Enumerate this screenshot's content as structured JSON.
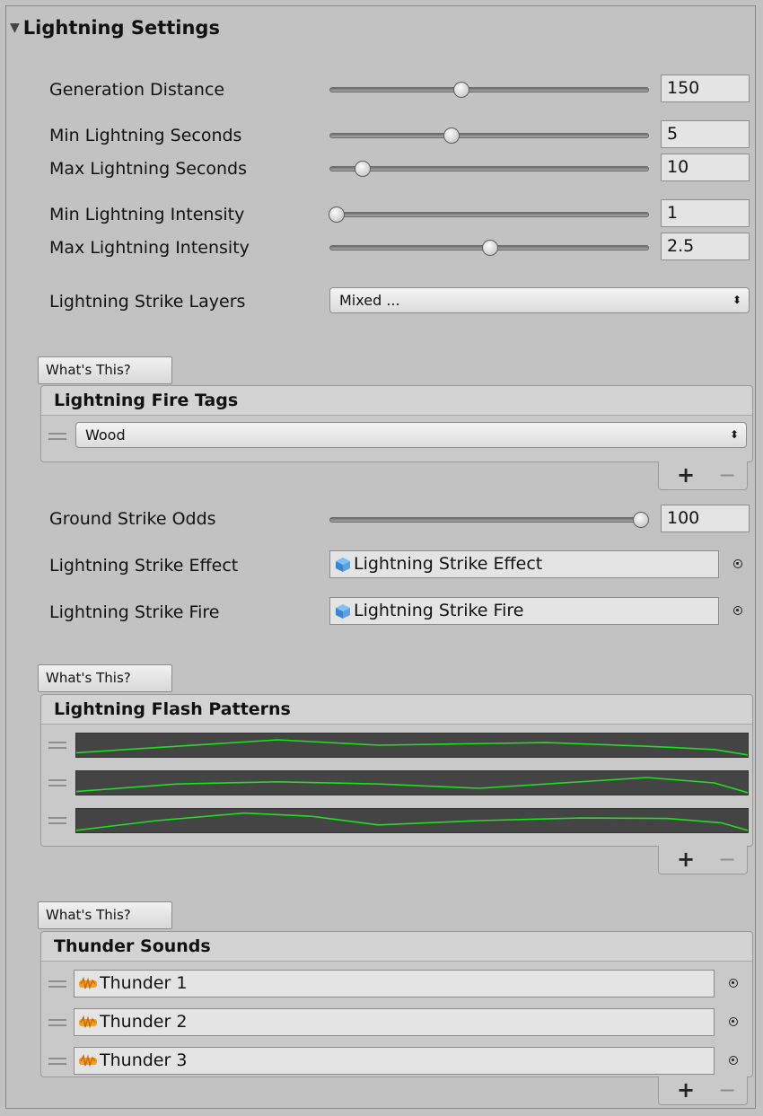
{
  "title": "Lightning Settings",
  "sliders": [
    {
      "label": "Generation Distance",
      "value": "150",
      "fraction": 0.41
    },
    {
      "label": "Min Lightning Seconds",
      "value": "5",
      "fraction": 0.38
    },
    {
      "label": "Max Lightning Seconds",
      "value": "10",
      "fraction": 0.1
    },
    {
      "label": "Min Lightning Intensity",
      "value": "1",
      "fraction": 0.02
    },
    {
      "label": "Max Lightning Intensity",
      "value": "2.5",
      "fraction": 0.5
    }
  ],
  "strike_layers": {
    "label": "Lightning Strike Layers",
    "value": "Mixed ..."
  },
  "whats_this": "What's This?",
  "fire_tags": {
    "header": "Lightning Fire Tags",
    "items": [
      "Wood"
    ]
  },
  "ground_strike": {
    "label": "Ground Strike Odds",
    "value": "100",
    "fraction": 1.0
  },
  "strike_effect": {
    "label": "Lightning Strike Effect",
    "value": "Lightning Strike Effect"
  },
  "strike_fire": {
    "label": "Lightning Strike Fire",
    "value": "Lightning Strike Fire"
  },
  "flash_patterns": {
    "header": "Lightning Flash Patterns",
    "curve_color": "#22dd22",
    "curves": [
      [
        [
          0,
          0.15
        ],
        [
          0.1,
          0.35
        ],
        [
          0.2,
          0.55
        ],
        [
          0.3,
          0.75
        ],
        [
          0.45,
          0.5
        ],
        [
          0.55,
          0.55
        ],
        [
          0.7,
          0.62
        ],
        [
          0.85,
          0.45
        ],
        [
          0.95,
          0.3
        ],
        [
          1,
          0.05
        ]
      ],
      [
        [
          0,
          0.1
        ],
        [
          0.15,
          0.45
        ],
        [
          0.3,
          0.55
        ],
        [
          0.45,
          0.45
        ],
        [
          0.6,
          0.25
        ],
        [
          0.75,
          0.55
        ],
        [
          0.85,
          0.75
        ],
        [
          0.95,
          0.5
        ],
        [
          1,
          0.05
        ]
      ],
      [
        [
          0,
          0.05
        ],
        [
          0.12,
          0.5
        ],
        [
          0.25,
          0.85
        ],
        [
          0.35,
          0.7
        ],
        [
          0.45,
          0.3
        ],
        [
          0.6,
          0.5
        ],
        [
          0.75,
          0.62
        ],
        [
          0.88,
          0.6
        ],
        [
          0.96,
          0.4
        ],
        [
          1,
          0.05
        ]
      ]
    ]
  },
  "thunder": {
    "header": "Thunder Sounds",
    "items": [
      "Thunder 1",
      "Thunder 2",
      "Thunder 3"
    ]
  },
  "icons": {
    "foldout": "triangle-down-icon",
    "prefab": "cube-icon",
    "audio": "audio-clip-icon",
    "picker": "object-picker-icon"
  },
  "add_label": "+",
  "remove_label": "−",
  "dropdown_arrows": "⬍"
}
